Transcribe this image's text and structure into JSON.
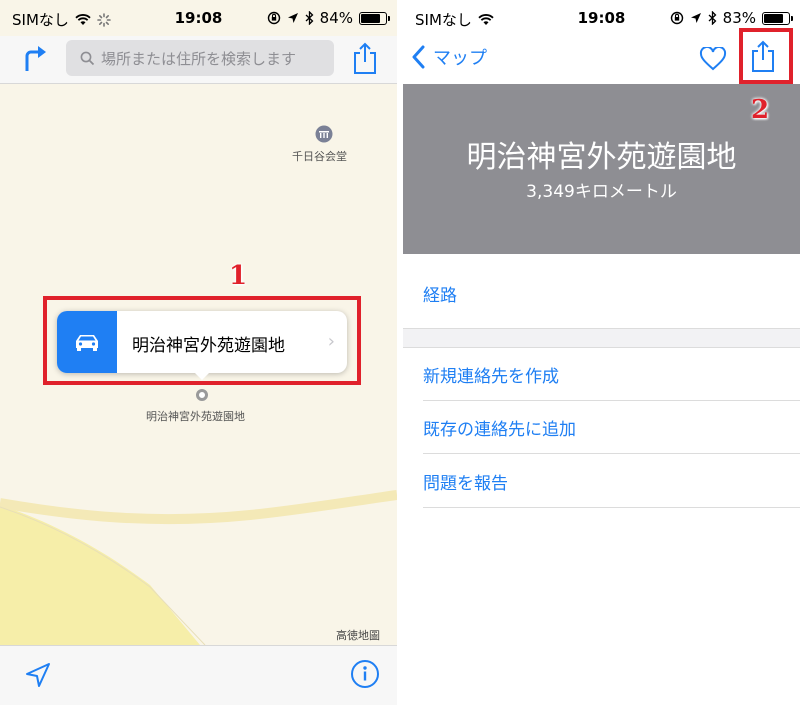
{
  "left": {
    "status": {
      "carrier": "SIMなし",
      "time": "19:08",
      "battery": "84%",
      "battery_level": 0.84
    },
    "search": {
      "placeholder": "場所または住所を検索します"
    },
    "map": {
      "poi_hall": "千日谷会堂",
      "pin_label": "明治神宮外苑遊園地",
      "attribution": "高徳地圖",
      "callout_title": "明治神宮外苑遊園地"
    },
    "annotation": "1"
  },
  "right": {
    "status": {
      "carrier": "SIMなし",
      "time": "19:08",
      "battery": "83%",
      "battery_level": 0.83
    },
    "nav": {
      "back_label": "マップ"
    },
    "header": {
      "place_name": "明治神宮外苑遊園地",
      "distance": "3,349キロメートル"
    },
    "actions": {
      "route": "経路",
      "new_contact": "新規連絡先を作成",
      "add_contact": "既存の連絡先に追加",
      "report": "問題を報告"
    },
    "annotation": "2"
  },
  "colors": {
    "accent": "#1f7ff3",
    "highlight": "#e0212b",
    "header_gray": "#8e8e93"
  }
}
